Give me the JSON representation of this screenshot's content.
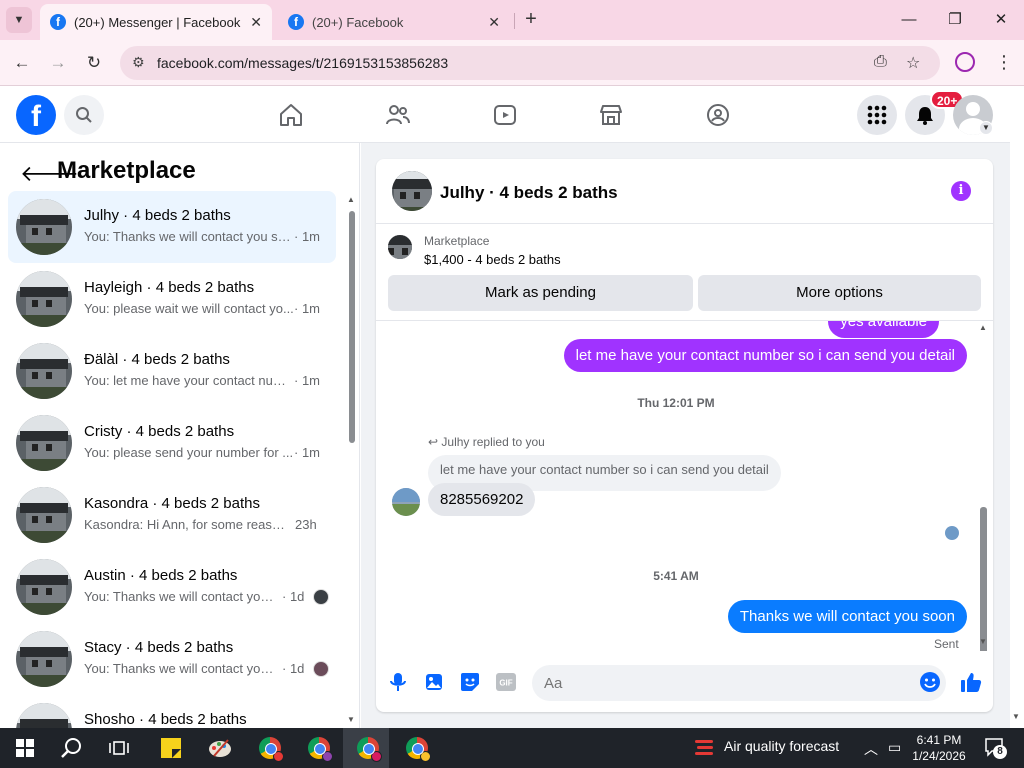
{
  "browser": {
    "tabs": [
      {
        "title": "(20+) Messenger | Facebook",
        "active": true
      },
      {
        "title": "(20+) Facebook",
        "active": false
      }
    ],
    "url": "facebook.com/messages/t/2169153153856283"
  },
  "fb_header": {
    "logo_letter": "f",
    "notification_badge": "20+"
  },
  "sidebar": {
    "title": "Marketplace",
    "conversations": [
      {
        "name": "Julhy · 4 beds 2 baths",
        "snippet": "You: Thanks we will contact you so...",
        "time": "· 1m",
        "selected": true
      },
      {
        "name": "Hayleigh · 4 beds 2 baths",
        "snippet": "You: please wait we will contact yo...",
        "time": "· 1m"
      },
      {
        "name": "Ðälàl · 4 beds 2 baths",
        "snippet": "You: let me have your contact num...",
        "time": "· 1m"
      },
      {
        "name": "Cristy · 4 beds 2 baths",
        "snippet": "You: please send your number for ...",
        "time": "· 1m"
      },
      {
        "name": "Kasondra · 4 beds 2 baths",
        "snippet": "Kasondra: Hi Ann, for some reaso...",
        "time": "23h"
      },
      {
        "name": "Austin · 4 beds 2 baths",
        "snippet": "You: Thanks we will contact you ...",
        "time": "· 1d"
      },
      {
        "name": "Stacy · 4 beds 2 baths",
        "snippet": "You: Thanks we will contact you ...",
        "time": "· 1d"
      },
      {
        "name": "Shosho · 4 beds 2 baths",
        "snippet": "",
        "time": ""
      }
    ]
  },
  "chat": {
    "title": "Julhy · 4 beds 2 baths",
    "marketplace_label": "Marketplace",
    "listing": "$1,400 - 4 beds 2 baths",
    "mark_pending": "Mark as pending",
    "more_options": "More options",
    "msg_partial": "yes available",
    "msg_contact": "let me have your contact number so i can send you detail",
    "stamp1": "Thu 12:01 PM",
    "replied_to": "Julhy replied to you",
    "quoted": "let me have your contact number so i can send you detail",
    "reply": "8285569202",
    "stamp2": "5:41 AM",
    "msg_last": "Thanks we will contact you soon",
    "sent": "Sent",
    "composer_placeholder": "Aa"
  },
  "taskbar": {
    "weather": "Air quality forecast",
    "time": "6:41 PM",
    "date": "1/24/2026",
    "notif_count": "8"
  },
  "colors": {
    "fb_blue": "#0866ff",
    "outgoing_purple": "#a033ff",
    "outgoing_blue": "#0a7cff",
    "badge_red": "#e41e3f"
  }
}
